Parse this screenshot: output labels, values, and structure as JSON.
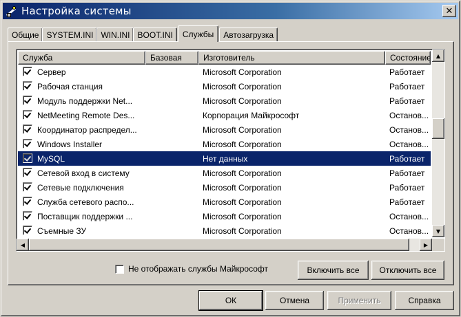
{
  "window": {
    "title": "Настройка системы",
    "close_glyph": "✕"
  },
  "tabs": [
    {
      "label": "Общие"
    },
    {
      "label": "SYSTEM.INI"
    },
    {
      "label": "WIN.INI"
    },
    {
      "label": "BOOT.INI"
    },
    {
      "label": "Службы",
      "active": true
    },
    {
      "label": "Автозагрузка"
    }
  ],
  "table": {
    "columns": [
      "Служба",
      "Базовая",
      "Изготовитель",
      "Состояние"
    ],
    "rows": [
      {
        "name": "Сервер",
        "base": "",
        "manufacturer": "Microsoft Corporation",
        "state": "Работает",
        "checked": true
      },
      {
        "name": "Рабочая станция",
        "base": "",
        "manufacturer": "Microsoft Corporation",
        "state": "Работает",
        "checked": true
      },
      {
        "name": "Модуль поддержки Net...",
        "base": "",
        "manufacturer": "Microsoft Corporation",
        "state": "Работает",
        "checked": true
      },
      {
        "name": "NetMeeting Remote Des...",
        "base": "",
        "manufacturer": "Корпорация Майкрософт",
        "state": "Останов...",
        "checked": true
      },
      {
        "name": "Координатор распредел...",
        "base": "",
        "manufacturer": "Microsoft Corporation",
        "state": "Останов...",
        "checked": true
      },
      {
        "name": "Windows Installer",
        "base": "",
        "manufacturer": "Microsoft Corporation",
        "state": "Останов...",
        "checked": true
      },
      {
        "name": "MySQL",
        "base": "",
        "manufacturer": "Нет данных",
        "state": "Работает",
        "checked": true,
        "selected": true
      },
      {
        "name": "Сетевой вход в систему",
        "base": "",
        "manufacturer": "Microsoft Corporation",
        "state": "Работает",
        "checked": true
      },
      {
        "name": "Сетевые подключения",
        "base": "",
        "manufacturer": "Microsoft Corporation",
        "state": "Работает",
        "checked": true
      },
      {
        "name": "Служба сетевого распо...",
        "base": "",
        "manufacturer": "Microsoft Corporation",
        "state": "Работает",
        "checked": true
      },
      {
        "name": "Поставщик поддержки ...",
        "base": "",
        "manufacturer": "Microsoft Corporation",
        "state": "Останов...",
        "checked": true
      },
      {
        "name": "Съемные ЗУ",
        "base": "",
        "manufacturer": "Microsoft Corporation",
        "state": "Останов...",
        "checked": true
      }
    ]
  },
  "scroll": {
    "up": "▲",
    "down": "▼",
    "left": "◀",
    "right": "▶"
  },
  "hide_ms": {
    "label": "Не отображать службы Майкрософт",
    "checked": false
  },
  "buttons": {
    "enable_all": "Включить все",
    "disable_all": "Отключить все",
    "ok": "ОК",
    "cancel": "Отмена",
    "apply": "Применить",
    "help": "Справка"
  },
  "colors": {
    "selection": "#0a246a",
    "face": "#d4d0c8",
    "title_start": "#0a246a"
  }
}
